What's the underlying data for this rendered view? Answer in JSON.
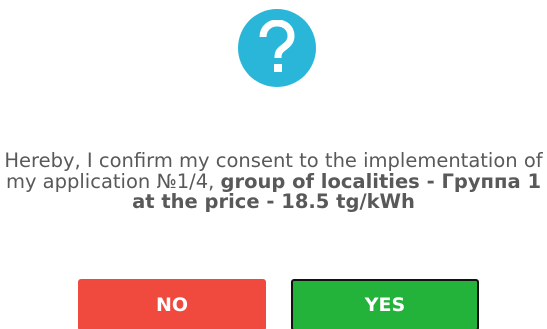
{
  "dialog": {
    "icon": "question-mark-icon",
    "icon_color": "#29b6d9",
    "message": {
      "part1": "Hereby, I confirm my consent to the implementation of my application №1/4, ",
      "part2": "group of localities - Группа 1 at the price - 18.5 tg/kWh"
    },
    "buttons": {
      "no_label": "NO",
      "yes_label": "YES"
    },
    "colors": {
      "no": "#f04a3f",
      "yes": "#23b33b"
    }
  }
}
